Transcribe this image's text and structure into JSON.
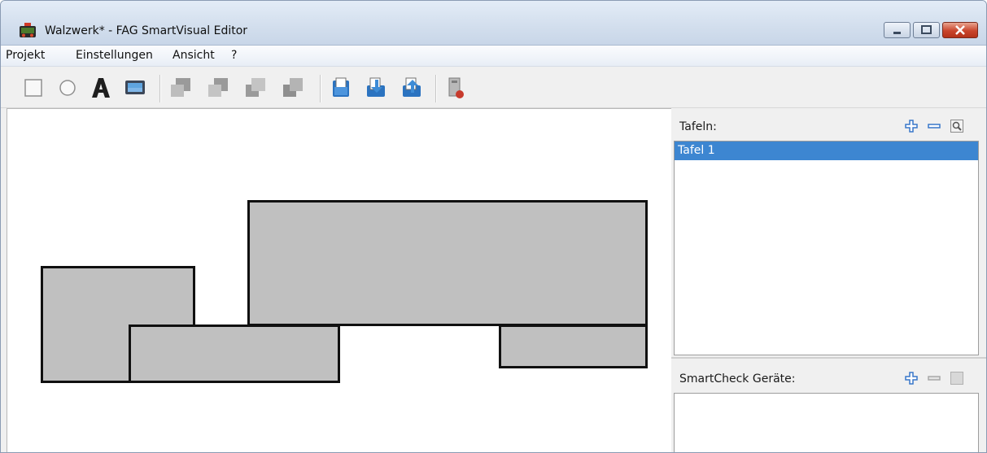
{
  "window": {
    "title": "Walzwerk* - FAG SmartVisual Editor",
    "accent": "#3d86d1"
  },
  "menu": {
    "items": [
      "Projekt",
      "Einstellungen",
      "Ansicht",
      "?"
    ]
  },
  "toolbar": {
    "tools": [
      "rectangle-tool-icon",
      "ellipse-tool-icon",
      "text-tool-icon",
      "image-tool-icon",
      "bring-to-front-icon",
      "bring-forward-icon",
      "send-backward-icon",
      "send-to-back-icon",
      "open-project-icon",
      "import-icon",
      "export-icon",
      "device-config-icon"
    ]
  },
  "tafeln": {
    "label": "Tafeln:",
    "items": [
      {
        "label": "Tafel 1",
        "selected": true
      }
    ]
  },
  "smartcheck": {
    "label": "SmartCheck Geräte:",
    "items": []
  }
}
